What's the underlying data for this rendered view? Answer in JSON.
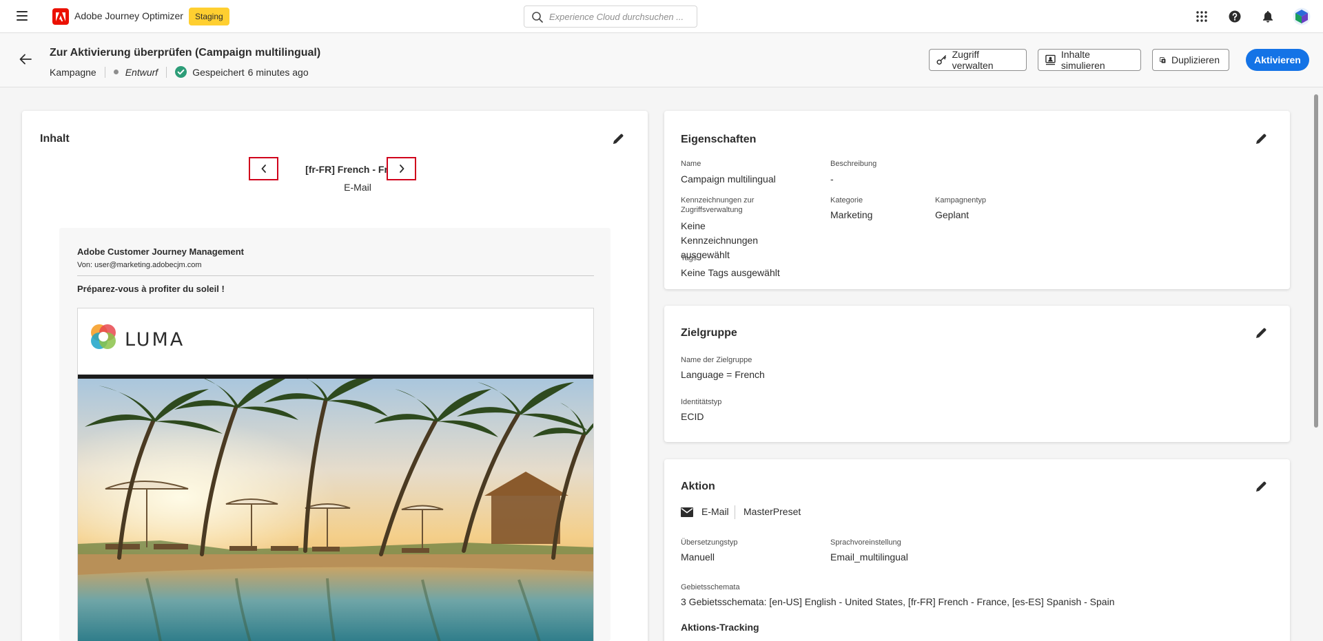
{
  "topbar": {
    "app_name": "Adobe Journey Optimizer",
    "env_badge": "Staging",
    "search_placeholder": "Experience Cloud durchsuchen ..."
  },
  "header": {
    "title": "Zur Aktivierung überprüfen (Campaign multilingual)",
    "type": "Kampagne",
    "status": "Entwurf",
    "saved": "Gespeichert",
    "saved_ago": "6 minutes ago",
    "buttons": {
      "access": "Zugriff verwalten",
      "simulate": "Inhalte simulieren",
      "duplicate": "Duplizieren",
      "activate": "Aktivieren"
    }
  },
  "content": {
    "title": "Inhalt",
    "locale": "[fr-FR] French - France",
    "channel": "E-Mail",
    "email": {
      "sender_name": "Adobe Customer Journey Management",
      "from": "Von: user@marketing.adobecjm.com",
      "subject": "Préparez-vous à profiter du soleil !",
      "brand": "LUMA"
    }
  },
  "properties": {
    "title": "Eigenschaften",
    "name_label": "Name",
    "name_value": "Campaign multilingual",
    "description_label": "Beschreibung",
    "description_value": "-",
    "access_labels_label": "Kennzeichnungen zur Zugriffsverwaltung",
    "access_labels_value": "Keine Kennzeichnungen ausgewählt",
    "category_label": "Kategorie",
    "category_value": "Marketing",
    "campaign_type_label": "Kampagnentyp",
    "campaign_type_value": "Geplant",
    "tags_label": "Tags",
    "tags_value": "Keine Tags ausgewählt"
  },
  "audience": {
    "title": "Zielgruppe",
    "name_label": "Name der Zielgruppe",
    "name_value": "Language = French",
    "identity_label": "Identitätstyp",
    "identity_value": "ECID"
  },
  "action": {
    "title": "Aktion",
    "channel": "E-Mail",
    "preset": "MasterPreset",
    "translation_label": "Übersetzungstyp",
    "translation_value": "Manuell",
    "language_label": "Sprachvoreinstellung",
    "language_value": "Email_multilingual",
    "locales_label": "Gebietsschemata",
    "locales_value": "3 Gebietsschemata: [en-US] English - United States, [fr-FR] French - France, [es-ES] Spanish - Spain",
    "tracking_title": "Aktions-Tracking"
  },
  "colors": {
    "accent": "#1473e6",
    "staging": "#ffcf30",
    "adobe_red": "#eb1000",
    "success": "#2d9d78",
    "highlight": "#d0021b"
  }
}
